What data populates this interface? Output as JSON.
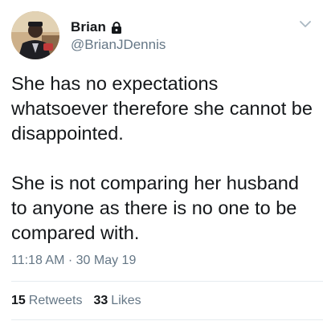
{
  "header": {
    "display_name": "Brian",
    "handle": "@BrianJDennis",
    "avatar_icon": "user-photo-avatar",
    "protected_icon": "lock-icon",
    "menu_icon": "chevron-down-icon"
  },
  "tweet": {
    "text": "She has no expectations whatsoever therefore she cannot be disappointed.\n\nShe is not comparing her husband to anyone as there is no one to be compared with.",
    "timestamp": "11:18 AM · 30 May 19"
  },
  "stats": {
    "retweets_count": "15",
    "retweets_label": "Retweets",
    "likes_count": "33",
    "likes_label": "Likes"
  },
  "colors": {
    "primary_text": "#14171a",
    "secondary_text": "#657786",
    "divider": "#e6ecf0"
  }
}
